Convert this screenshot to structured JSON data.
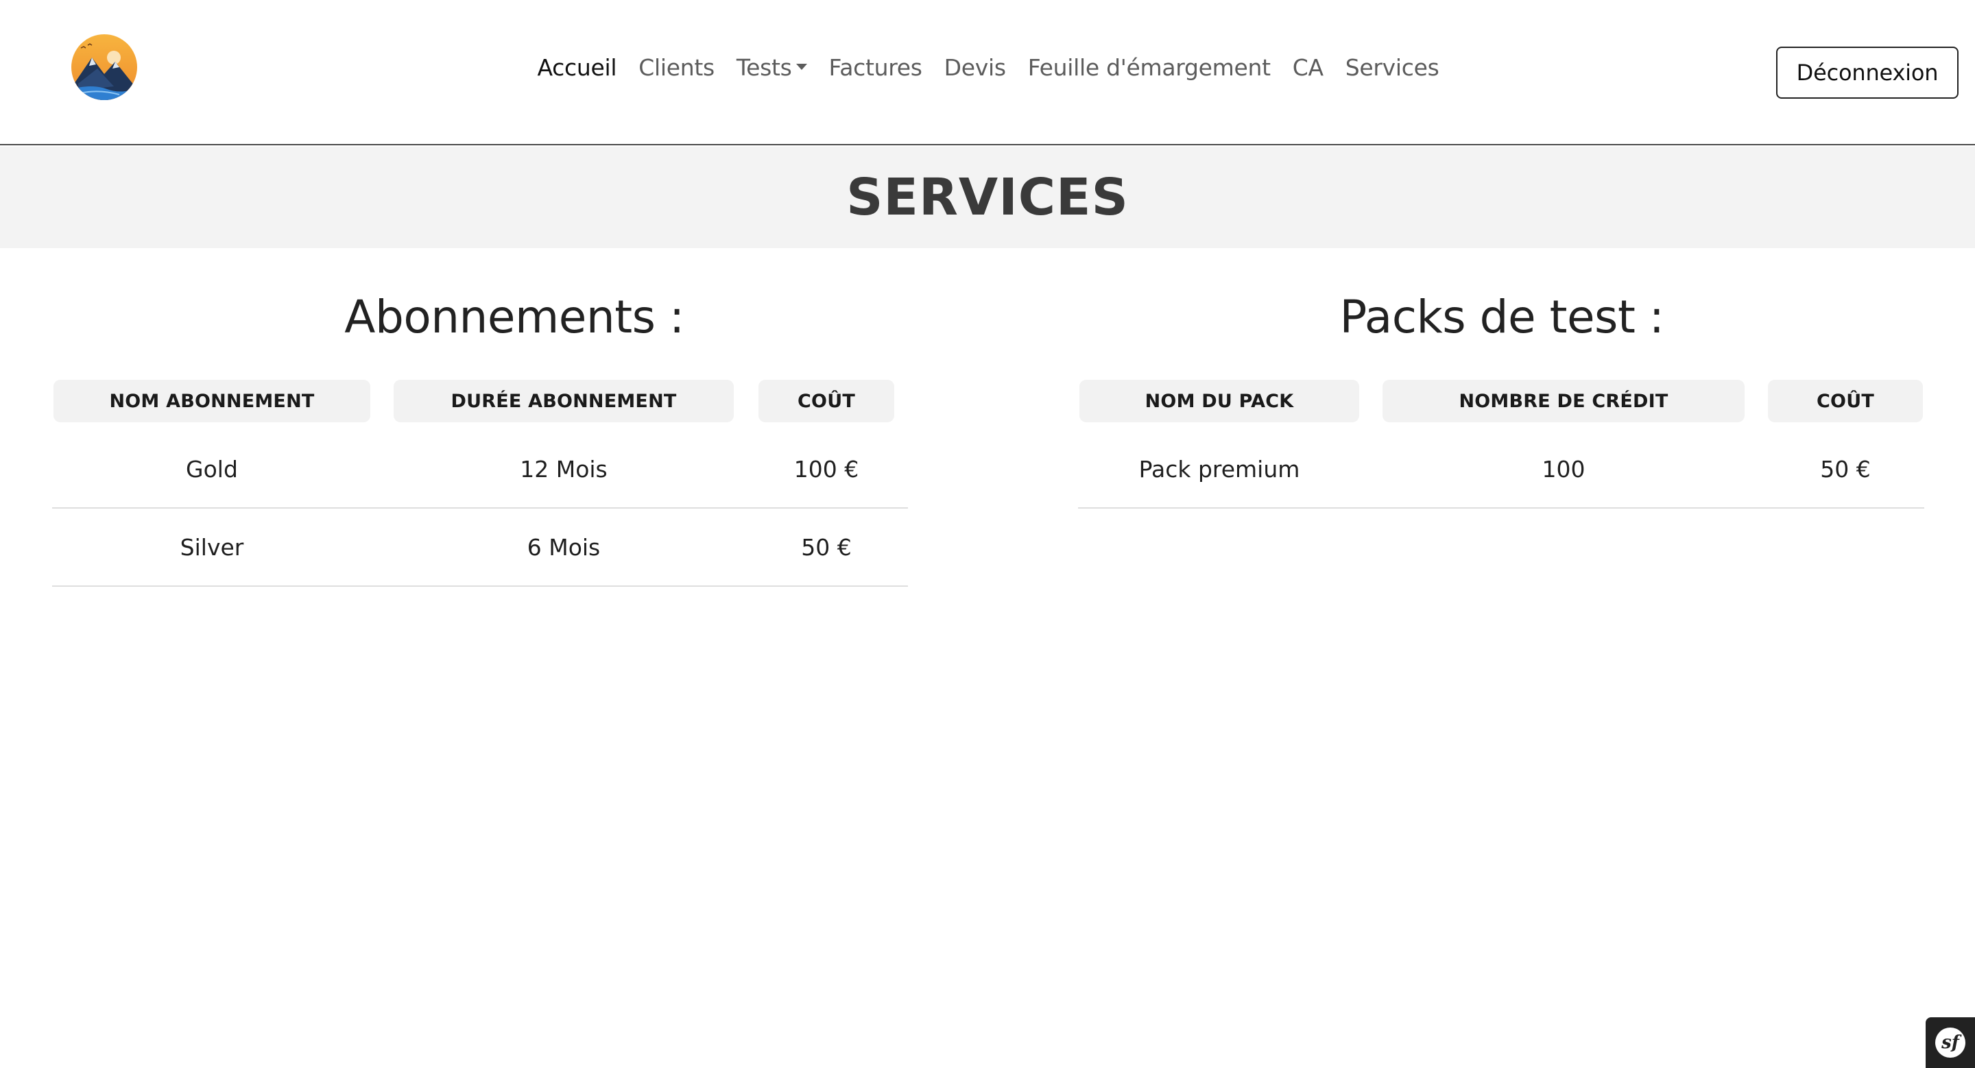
{
  "nav": {
    "links": [
      {
        "label": "Accueil"
      },
      {
        "label": "Clients"
      },
      {
        "label": "Tests"
      },
      {
        "label": "Factures"
      },
      {
        "label": "Devis"
      },
      {
        "label": "Feuille d'émargement"
      },
      {
        "label": "CA"
      },
      {
        "label": "Services"
      }
    ],
    "logout_label": "Déconnexion"
  },
  "banner": {
    "title": "SERVICES"
  },
  "subscriptions": {
    "title": "Abonnements :",
    "headers": [
      "NOM ABONNEMENT",
      "DURÉE ABONNEMENT",
      "COÛT"
    ],
    "rows": [
      [
        "Gold",
        "12 Mois",
        "100 €"
      ],
      [
        "Silver",
        "6 Mois",
        "50 €"
      ]
    ]
  },
  "packs": {
    "title": "Packs de test :",
    "headers": [
      "NOM DU PACK",
      "NOMBRE DE CRÉDIT",
      "COÛT"
    ],
    "rows": [
      [
        "Pack premium",
        "100",
        "50 €"
      ]
    ]
  },
  "debug_toolbar": {
    "icon": "symfony-icon",
    "glyph": "sf"
  },
  "colors": {
    "logo_sun": "#f5a53a",
    "logo_mountain": "#1f3558",
    "logo_water": "#2f7fd1",
    "banner_bg": "#f3f3f3",
    "header_cell_bg": "#f2f2f2"
  }
}
